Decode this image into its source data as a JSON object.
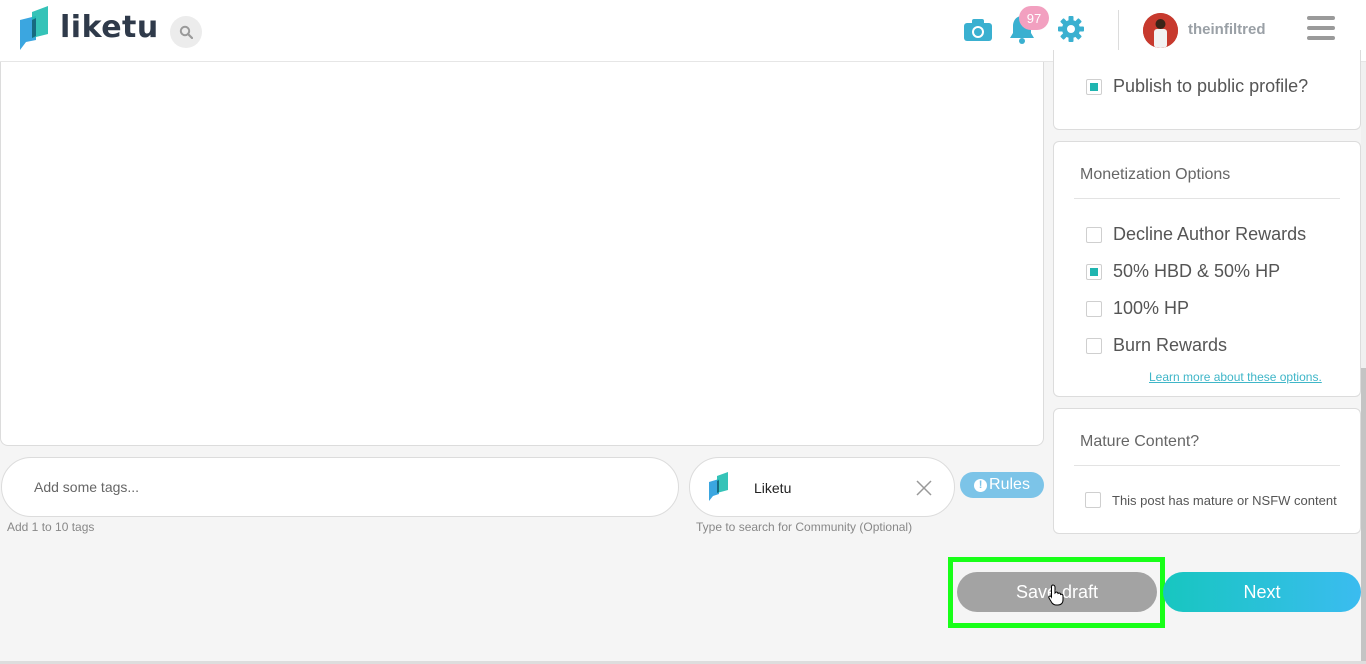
{
  "header": {
    "brand": "liketu",
    "notification_count": "97",
    "username": "theinfiltred"
  },
  "editor": {
    "tags_placeholder": "Add some tags...",
    "tags_help": "Add 1 to 10 tags",
    "community_name": "Liketu",
    "community_help": "Type to search for Community (Optional)",
    "rules_label": "Rules"
  },
  "publish": {
    "label": "Publish to public profile?",
    "checked": true
  },
  "monetization": {
    "title": "Monetization Options",
    "options": [
      {
        "label": "Decline Author Rewards",
        "checked": false
      },
      {
        "label": "50% HBD & 50% HP",
        "checked": true
      },
      {
        "label": "100% HP",
        "checked": false
      },
      {
        "label": "Burn Rewards",
        "checked": false
      }
    ],
    "learn_more": "Learn more about these options."
  },
  "mature": {
    "title": "Mature Content?",
    "label": "This post has mature or NSFW content",
    "checked": false
  },
  "actions": {
    "save_draft": "Save draft",
    "next": "Next"
  },
  "colors": {
    "accent": "#1fb5b0",
    "rules": "#7cc4e8",
    "badge": "#f2a0c0",
    "highlight": "#18ff18"
  }
}
